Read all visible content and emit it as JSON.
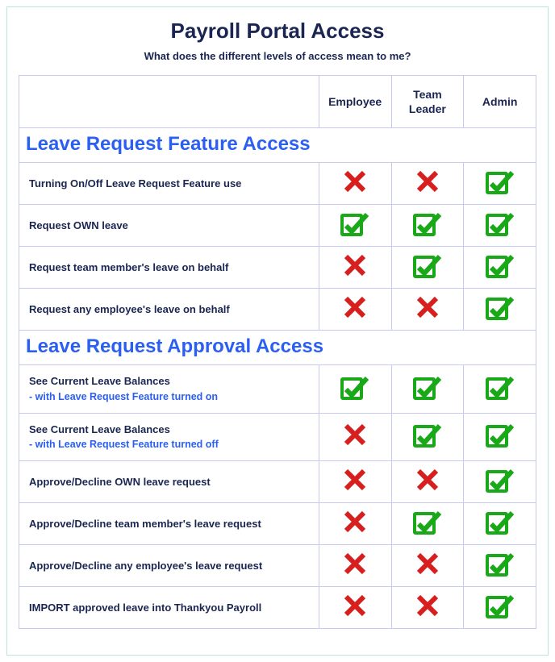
{
  "title": "Payroll Portal Access",
  "subtitle": "What does the different levels of access mean to me?",
  "roles": [
    "Employee",
    "Team Leader",
    "Admin"
  ],
  "sections": [
    {
      "heading": "Leave Request Feature Access",
      "rows": [
        {
          "label": "Turning On/Off Leave Request Feature use",
          "subnote": "",
          "values": [
            "no",
            "no",
            "yes"
          ]
        },
        {
          "label": "Request OWN leave",
          "subnote": "",
          "values": [
            "yes",
            "yes",
            "yes"
          ]
        },
        {
          "label": "Request team member's leave on behalf",
          "subnote": "",
          "values": [
            "no",
            "yes",
            "yes"
          ]
        },
        {
          "label": "Request any employee's leave on behalf",
          "subnote": "",
          "values": [
            "no",
            "no",
            "yes"
          ]
        }
      ]
    },
    {
      "heading": "Leave Request Approval Access",
      "rows": [
        {
          "label": "See Current Leave Balances",
          "subnote": " - with Leave Request Feature turned on",
          "values": [
            "yes",
            "yes",
            "yes"
          ]
        },
        {
          "label": "See Current Leave Balances",
          "subnote": " - with Leave Request Feature turned off",
          "values": [
            "no",
            "yes",
            "yes"
          ]
        },
        {
          "label": "Approve/Decline OWN leave request",
          "subnote": "",
          "values": [
            "no",
            "no",
            "yes"
          ]
        },
        {
          "label": "Approve/Decline team member's leave request",
          "subnote": "",
          "values": [
            "no",
            "yes",
            "yes"
          ]
        },
        {
          "label": "Approve/Decline any employee's leave request",
          "subnote": "",
          "values": [
            "no",
            "no",
            "yes"
          ]
        },
        {
          "label": "IMPORT approved leave into Thankyou Payroll",
          "subnote": "",
          "values": [
            "no",
            "no",
            "yes"
          ]
        }
      ]
    }
  ],
  "colors": {
    "accent_blue": "#2b5ff2",
    "heading_navy": "#1a2651",
    "border": "#c7c9f0",
    "check_green": "#18a818",
    "cross_red": "#d81f1f"
  }
}
